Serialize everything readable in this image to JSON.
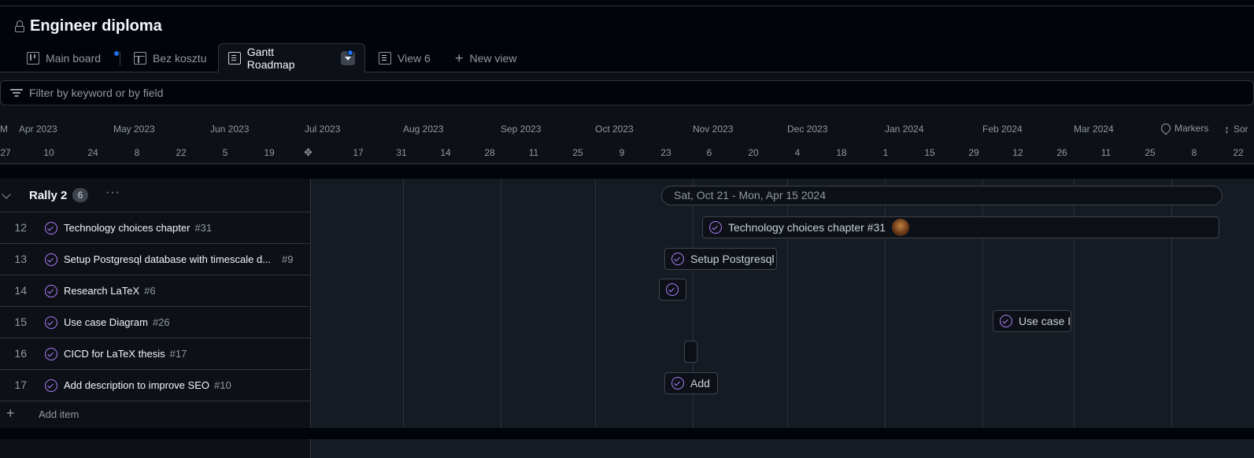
{
  "project": {
    "title": "Engineer diploma",
    "lock_icon": "lock-icon"
  },
  "tabs": [
    {
      "label": "Main board",
      "icon": "board-icon",
      "unsaved": true
    },
    {
      "label": "Bez kosztu",
      "icon": "table-icon"
    },
    {
      "label": "Gantt Roadmap",
      "icon": "roadmap-icon",
      "active": true,
      "unsaved": true
    },
    {
      "label": "View 6",
      "icon": "roadmap-icon"
    },
    {
      "label": "New view",
      "icon": "plus-icon"
    }
  ],
  "filter": {
    "placeholder": "Filter by keyword or by field"
  },
  "timeline": {
    "months": [
      "M",
      "Apr 2023",
      "May 2023",
      "Jun 2023",
      "Jul 2023",
      "Aug 2023",
      "Sep 2023",
      "Oct 2023",
      "Nov 2023",
      "Dec 2023",
      "Jan 2024",
      "Feb 2024",
      "Mar 2024"
    ],
    "days": [
      "27",
      "10",
      "24",
      "8",
      "22",
      "5",
      "19",
      "17",
      "31",
      "14",
      "28",
      "11",
      "25",
      "9",
      "23",
      "6",
      "20",
      "4",
      "18",
      "1",
      "15",
      "29",
      "12",
      "26",
      "11",
      "25",
      "8",
      "22"
    ],
    "markers_label": "Markers",
    "sort_label": "Sor"
  },
  "group": {
    "name": "Rally 2",
    "count": "6",
    "more": "···",
    "date_range": "Sat, Oct 21 - Mon, Apr 15 2024"
  },
  "items": [
    {
      "num": "12",
      "title": "Technology choices chapter",
      "issue": "#31",
      "bar_label": "Technology choices chapter #31"
    },
    {
      "num": "13",
      "title": "Setup Postgresql database with timescale d...",
      "issue": "#9",
      "bar_label": "Setup Postgresql"
    },
    {
      "num": "14",
      "title": "Research LaTeX",
      "issue": "#6",
      "bar_label": ""
    },
    {
      "num": "15",
      "title": "Use case Diagram",
      "issue": "#26",
      "bar_label": "Use case I"
    },
    {
      "num": "16",
      "title": "CICD for LaTeX thesis",
      "issue": "#17",
      "bar_label": ""
    },
    {
      "num": "17",
      "title": "Add description to improve SEO",
      "issue": "#10",
      "bar_label": "Add"
    }
  ],
  "add_item": {
    "label": "Add item"
  },
  "colors": {
    "accent": "#1f6feb",
    "issue_open": "#ab7df8",
    "bg": "#0d1117"
  }
}
